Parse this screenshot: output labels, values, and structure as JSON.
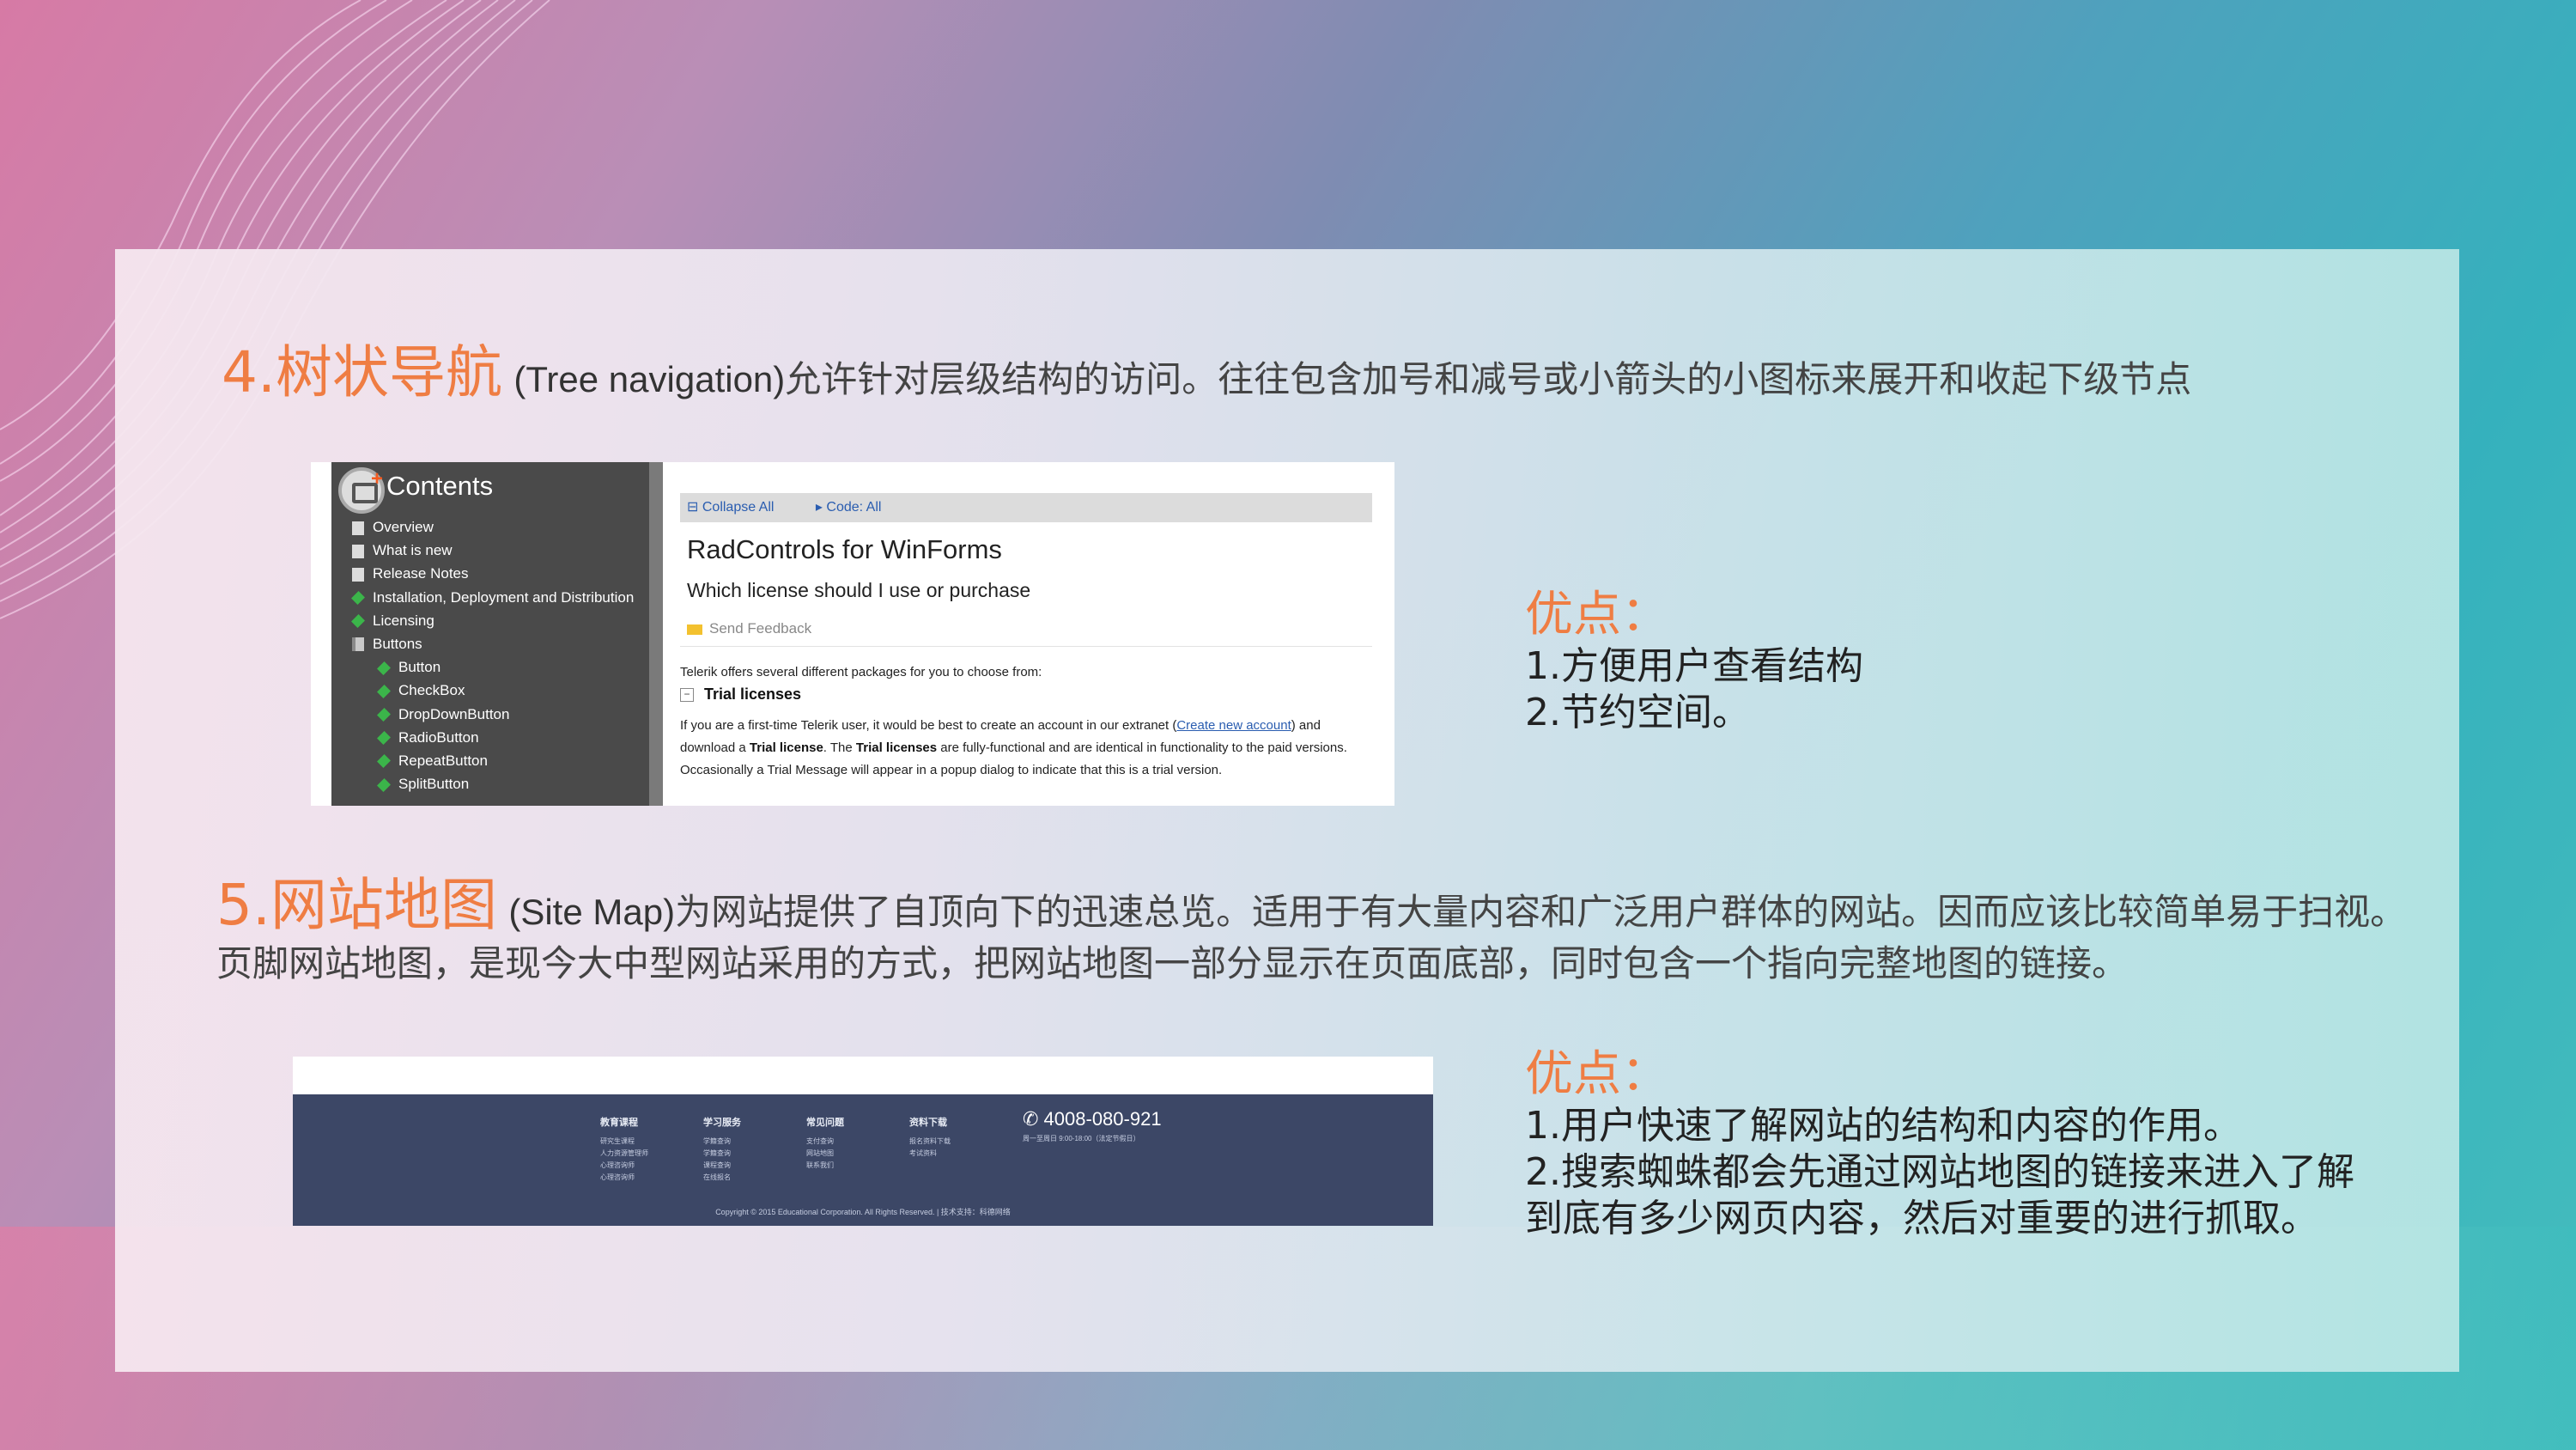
{
  "section4": {
    "number": "4.树状导航",
    "en": "(Tree navigation)",
    "text": "允许针对层级结构的访问。往往包含加号和减号或小箭头的小图标来展开和收起下级节点"
  },
  "section4_adv": {
    "title": "优点：",
    "items": [
      "1.方便用户查看结构",
      "2.节约空间。"
    ]
  },
  "tree_shot": {
    "title": "Contents",
    "items": [
      {
        "label": "Overview",
        "icon": "doc-icon",
        "indent": 0
      },
      {
        "label": "What is new",
        "icon": "doc-icon",
        "indent": 0
      },
      {
        "label": "Release Notes",
        "icon": "doc-icon",
        "indent": 0
      },
      {
        "label": "Installation, Deployment and Distribution",
        "icon": "gem-icon",
        "indent": 0
      },
      {
        "label": "Licensing",
        "icon": "gem-icon",
        "indent": 0
      },
      {
        "label": "Buttons",
        "icon": "book-icon",
        "indent": 0
      },
      {
        "label": "Button",
        "icon": "gem-icon",
        "indent": 1
      },
      {
        "label": "CheckBox",
        "icon": "gem-icon",
        "indent": 1
      },
      {
        "label": "DropDownButton",
        "icon": "gem-icon",
        "indent": 1
      },
      {
        "label": "RadioButton",
        "icon": "gem-icon",
        "indent": 1
      },
      {
        "label": "RepeatButton",
        "icon": "gem-icon",
        "indent": 1
      },
      {
        "label": "SplitButton",
        "icon": "gem-icon",
        "indent": 1
      }
    ],
    "collapse_all": "Collapse All",
    "code_all": "Code: All",
    "heading": "RadControls for WinForms",
    "subheading": "Which license should I use or purchase",
    "send_feedback": "Send Feedback",
    "intro": "Telerik offers several different packages for you to choose from:",
    "trial_title": "Trial licenses",
    "body1": "If you are a first-time Telerik user, it would be best to create an account in our extranet (",
    "body_link": "Create new account",
    "body2": ") and download a ",
    "body_trial1": "Trial license",
    "body3": ". The ",
    "body_trial2": "Trial licenses",
    "body4": " are fully-functional and are identical in functionality to the paid versions. Occasionally a Trial Message will appear in a popup dialog to indicate that this is a trial version."
  },
  "section5": {
    "number": "5.网站地图",
    "en": "(Site Map)",
    "text": "为网站提供了自顶向下的迅速总览。适用于有大量内容和广泛用户群体的网站。因而应该比较简单易于扫视。页脚网站地图，是现今大中型网站采用的方式，把网站地图一部分显示在页面底部，同时包含一个指向完整地图的链接。"
  },
  "section5_adv": {
    "title": "优点：",
    "items": [
      "1.用户快速了解网站的结构和内容的作用。",
      "2.搜索蜘蛛都会先通过网站地图的链接来进入了解到底有多少网页内容，然后对重要的进行抓取。"
    ]
  },
  "footer_shot": {
    "columns": [
      {
        "heading": "教育课程",
        "items": [
          "研究生课程",
          "人力资源管理师",
          "心理咨询师",
          "心理咨询师"
        ]
      },
      {
        "heading": "学习服务",
        "items": [
          "学籍查询",
          "学籍查询",
          "课程查询",
          "在线报名"
        ]
      },
      {
        "heading": "常见问题",
        "items": [
          "支付查询",
          "网站地图",
          "联系我们"
        ]
      },
      {
        "heading": "资料下载",
        "items": [
          "报名资料下载",
          "考试资料"
        ]
      }
    ],
    "phone": "4008-080-921",
    "phone_sub": "周一至周日 9:00-18:00（法定节假日）",
    "copyright": "Copyright © 2015 Educational Corporation. All Rights Reserved.  |  技术支持：科德网络"
  }
}
